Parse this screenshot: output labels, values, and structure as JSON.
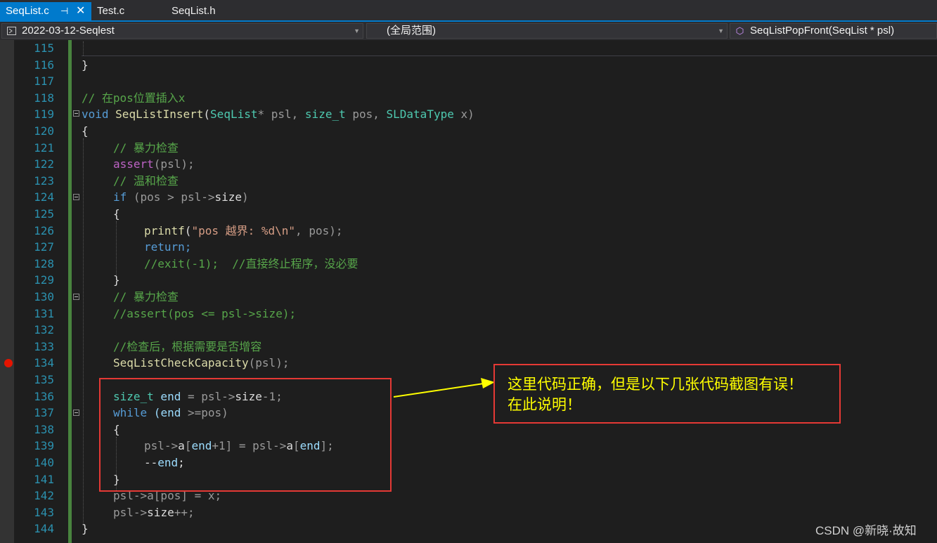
{
  "tabs": [
    {
      "label": "SeqList.c",
      "active": true
    },
    {
      "label": "Test.c",
      "active": false
    },
    {
      "label": "SeqList.h",
      "active": false
    }
  ],
  "navbar": {
    "project": "2022-03-12-Seqlest",
    "scope": "(全局范围)",
    "function": "SeqListPopFront(SeqList * psl)"
  },
  "line_numbers": [
    "115",
    "116",
    "117",
    "118",
    "119",
    "120",
    "121",
    "122",
    "123",
    "124",
    "125",
    "126",
    "127",
    "128",
    "129",
    "130",
    "131",
    "132",
    "133",
    "134",
    "135",
    "136",
    "137",
    "138",
    "139",
    "140",
    "141",
    "142",
    "143",
    "144"
  ],
  "code": {
    "l116": "}",
    "l118": "// 在pos位置插入x",
    "l119_void": "void",
    "l119_fn": "SeqListInsert",
    "l119_p1": "(",
    "l119_t1": "SeqList",
    "l119_p2": "* psl, ",
    "l119_t2": "size_t",
    "l119_p3": " pos, ",
    "l119_t3": "SLDataType",
    "l119_p4": " x)",
    "l120": "{",
    "l121": "// 暴力检查",
    "l122_fn": "assert",
    "l122_rest": "(psl);",
    "l123": "// 温和检查",
    "l124_kw": "if",
    "l124_a": " (pos > psl->",
    "l124_b": "size",
    "l124_c": ")",
    "l125": "{",
    "l126_fn": "printf",
    "l126_a": "(",
    "l126_str": "\"pos 越界: %d\\n\"",
    "l126_b": ", pos);",
    "l127": "return;",
    "l128": "//exit(-1);  //直接终止程序，没必要",
    "l129": "}",
    "l130": "// 暴力检查",
    "l131": "//assert(pos <= psl->size);",
    "l133": "//检查后，根据需要是否增容",
    "l134_fn": "SeqListCheckCapacity",
    "l134_rest": "(psl);",
    "l136_ty": "size_t",
    "l136_a": " end",
    "l136_b": " = psl->",
    "l136_c": "size",
    "l136_d": "-1;",
    "l137_kw": "while",
    "l137_a": " (end",
    "l137_b": " >=pos)",
    "l138": "{",
    "l139_a": "psl->",
    "l139_b": "a",
    "l139_c": "[",
    "l139_d": "end",
    "l139_e": "+1] = psl->",
    "l139_f": "a",
    "l139_g": "[",
    "l139_h": "end",
    "l139_i": "];",
    "l140_a": "--",
    "l140_b": "end",
    "l140_c": ";",
    "l141": "}",
    "l142": "psl->a[pos] = x;",
    "l143_a": "psl->",
    "l143_b": "size",
    "l143_c": "++;",
    "l144": "}"
  },
  "annotation": {
    "line1": "这里代码正确，但是以下几张代码截图有误！",
    "line2": "在此说明！"
  },
  "watermark": "CSDN @新晓·故知",
  "colors": {
    "accent": "#007acc",
    "comment": "#57a64a",
    "keyword": "#569cd6",
    "type": "#4ec9b0",
    "function": "#dcdcaa",
    "annotation": "#ffff00",
    "box": "#e53935"
  }
}
